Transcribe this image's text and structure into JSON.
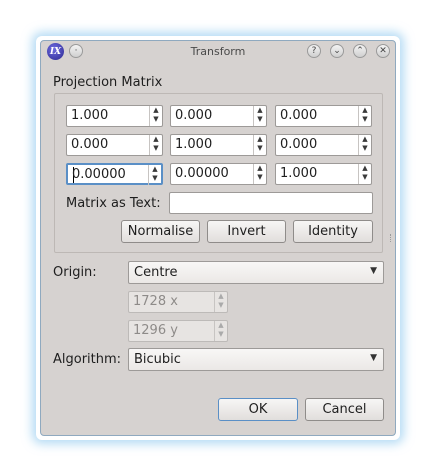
{
  "window": {
    "title": "Transform",
    "app_icon_text": "IX",
    "buttons": {
      "help": "?",
      "shade": "⌄",
      "maximize": "⌃",
      "close": "✕"
    }
  },
  "projection": {
    "label": "Projection Matrix",
    "matrix": [
      [
        "1.000",
        "0.000",
        "0.000"
      ],
      [
        "0.000",
        "1.000",
        "0.000"
      ],
      [
        "0.00000",
        "0.00000",
        "1.000"
      ]
    ],
    "matrix_text_label": "Matrix as Text:",
    "matrix_text_value": "",
    "buttons": {
      "normalise": "Normalise",
      "invert": "Invert",
      "identity": "Identity"
    }
  },
  "origin": {
    "label": "Origin:",
    "selected": "Centre",
    "x": "1728 x",
    "y": "1296 y"
  },
  "algorithm": {
    "label": "Algorithm:",
    "selected": "Bicubic"
  },
  "footer": {
    "ok": "OK",
    "cancel": "Cancel"
  }
}
